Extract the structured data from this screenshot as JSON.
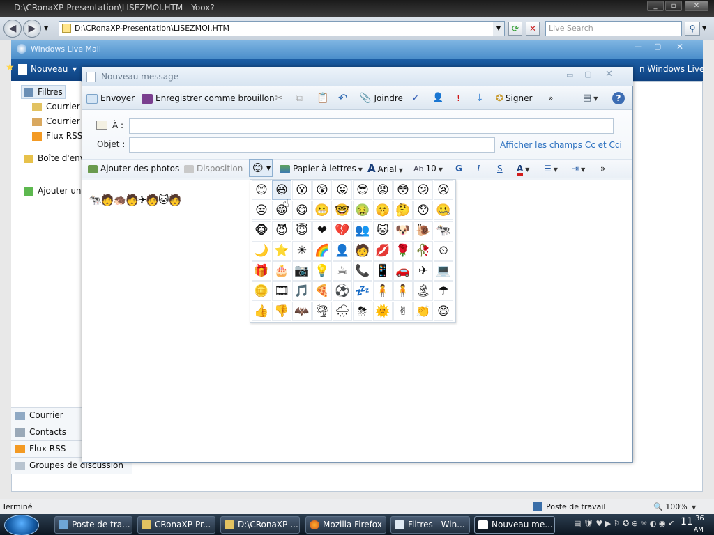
{
  "firefox": {
    "title": "D:\\CRonaXP-Presentation\\LISEZMOI.HTM - Yoox?",
    "url": "D:\\CRonaXP-Presentation\\LISEZMOI.HTM",
    "search_placeholder": "Live Search",
    "status_text": "Terminé",
    "zone": "Poste de travail",
    "zoom": "100%"
  },
  "wlm": {
    "title": "Windows Live Mail",
    "new_button": "Nouveau",
    "signin": "n Windows Live",
    "sidebar": {
      "filters": "Filtres",
      "items": [
        "Courrier",
        "Courrier",
        "Flux RSS"
      ],
      "outbox": "Boîte d'envo",
      "add": "Ajouter un c"
    },
    "bottom_nav": [
      "Courrier",
      "Contacts",
      "Flux RSS",
      "Groupes de discussion"
    ]
  },
  "dialog": {
    "title": "Nouveau message",
    "toolbar": {
      "send": "Envoyer",
      "save_draft": "Enregistrer comme brouillon",
      "attach": "Joindre",
      "sign": "Signer",
      "more": "»"
    },
    "to_label": "À :",
    "subject_label": "Objet :",
    "show_cc": "Afficher les champs Cc et Cci",
    "format": {
      "add_photos": "Ajouter des photos",
      "layout": "Disposition",
      "stationery": "Papier à lettres",
      "font": "Arial",
      "size": "10",
      "bold": "G",
      "italic": "I",
      "underline": "S",
      "more": "»"
    },
    "body_emoticons": "🐄🧑🦔🧑✈🧑🐱🧑"
  },
  "emoticons": [
    "😊",
    "😃",
    "😮",
    "😲",
    "😛",
    "😎",
    "😡",
    "😳",
    "😕",
    "😢",
    "😒",
    "😁",
    "😋",
    "😬",
    "🤓",
    "🤢",
    "🤫",
    "🤔",
    "😯",
    "🤐",
    "🐵",
    "😈",
    "😇",
    "❤",
    "💔",
    "👥",
    "🐱",
    "🐶",
    "🐌",
    "🐄",
    "🌙",
    "⭐",
    "☀",
    "🌈",
    "👤",
    "🧑",
    "💋",
    "🌹",
    "🥀",
    "⏲",
    "🎁",
    "🎂",
    "📷",
    "💡",
    "☕",
    "📞",
    "📱",
    "🚗",
    "✈",
    "💻",
    "🪙",
    "🎞",
    "🎵",
    "🍕",
    "⚽",
    "💤",
    "🧍",
    "🧍",
    "🏝",
    "☂",
    "👍",
    "👎",
    "🦇",
    "🌪",
    "🌧",
    "⛈",
    "🌞",
    "✌",
    "👏",
    "😄"
  ],
  "taskbar": {
    "buttons": [
      "Poste de tra...",
      "CRonaXP-Pr...",
      "D:\\CRonaXP-...",
      "Mozilla Firefox",
      "Filtres - Win...",
      "Nouveau me..."
    ],
    "time": "11",
    "time_min": "36",
    "ampm": "AM"
  }
}
